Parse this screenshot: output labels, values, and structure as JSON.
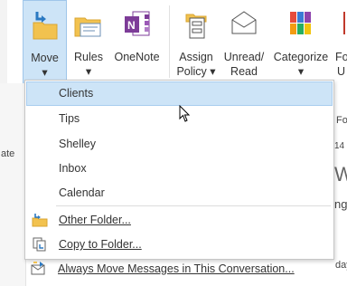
{
  "ribbon": {
    "buttons": [
      {
        "id": "move",
        "label": "Move",
        "label2": "▾"
      },
      {
        "id": "rules",
        "label": "Rules",
        "label2": "▾"
      },
      {
        "id": "onenote",
        "label": "OneNote",
        "label2": ""
      },
      {
        "id": "assign",
        "label": "Assign",
        "label2": "Policy ▾"
      },
      {
        "id": "unread",
        "label": "Unread/",
        "label2": "Read"
      },
      {
        "id": "categorize",
        "label": "Categorize",
        "label2": "▾"
      },
      {
        "id": "follow",
        "label": "Fo",
        "label2": "U"
      }
    ]
  },
  "background": {
    "left_text": "ate",
    "right_fo": "Fo",
    "right_14": "14",
    "right_w": "W",
    "right_ng": "ng",
    "right_day": "day"
  },
  "menu": {
    "folders": [
      "Clients",
      "Tips",
      "Shelley",
      "Inbox",
      "Calendar"
    ],
    "other_folder": "Other Folder...",
    "copy_to_folder": "Copy to Folder...",
    "always_move": "Always Move Messages in This Conversation..."
  },
  "colors": {
    "highlight": "#cde4f7",
    "accent": "#2b79c2"
  }
}
